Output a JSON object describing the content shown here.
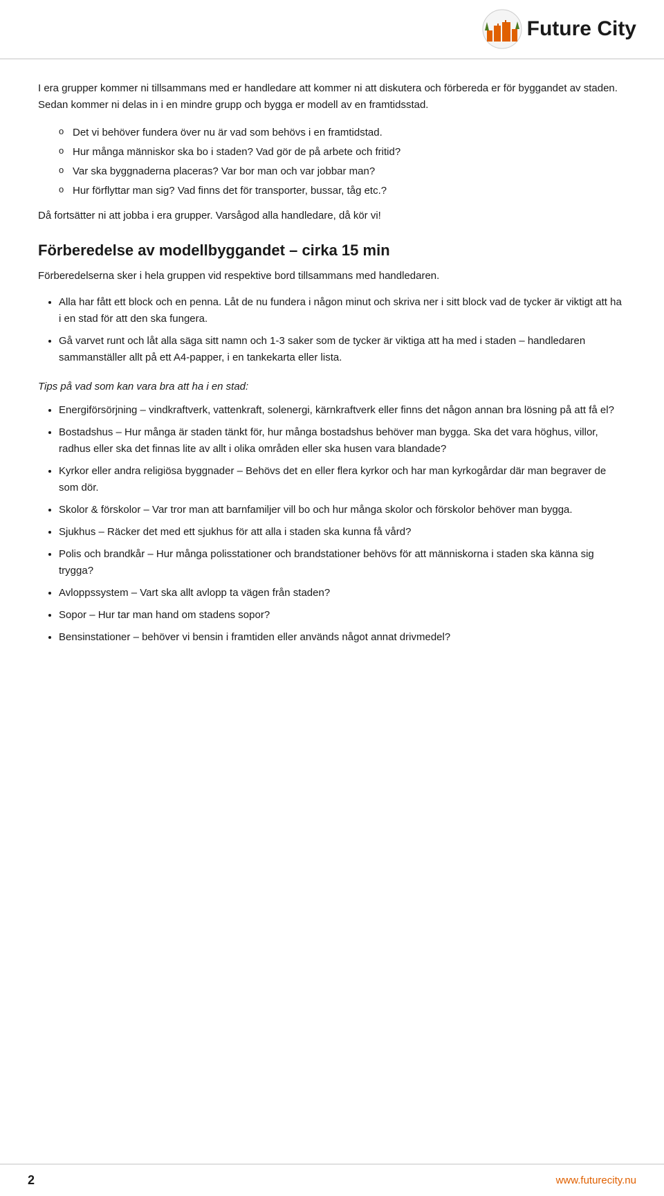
{
  "header": {
    "logo_text": "Future City",
    "logo_future": "Future",
    "logo_city": "City"
  },
  "content": {
    "intro_paragraph": "I era grupper kommer ni tillsammans med er handledare att kommer ni att diskutera och förbereda er för byggandet av staden. Sedan kommer ni delas in i en mindre grupp och bygga er modell av en framtidsstad.",
    "bullet_items": [
      "Det vi behöver fundera över nu är vad som behövs i en framtidstad.",
      "Hur många människor ska bo i staden? Vad gör de på arbete och fritid?",
      "Var ska byggnaderna placeras? Var bor man och var jobbar man?",
      "Hur förflyttar man sig? Vad finns det för transporter, bussar, tåg etc.?"
    ],
    "continuation1": "Då fortsätter ni att jobba i era grupper. Varsågod alla handledare, då kör vi!",
    "section_heading": "Förberedelse av modellbyggandet – cirka 15 min",
    "section_sub_text": "Förberedelserna sker i hela gruppen vid respektive bord tillsammans med handledaren.",
    "dot_items": [
      "Alla har fått ett block och en penna. Låt de nu fundera i någon minut och skriva ner i sitt block vad de tycker är viktigt att ha i en stad för att den ska fungera.",
      "Gå varvet runt och låt alla säga sitt namn och 1-3 saker som de tycker är viktiga att ha med i staden – handledaren sammanställer allt på ett A4-papper, i en tankekarta eller lista."
    ],
    "tips_heading": "Tips på vad som kan vara bra att ha i en stad:",
    "tips_items": [
      "Energiförsörjning – vindkraftverk, vattenkraft, solenergi, kärnkraftverk eller finns det någon annan bra lösning på att få el?",
      "Bostadshus – Hur många är staden tänkt för, hur många bostadshus behöver man bygga. Ska det vara höghus, villor, radhus eller ska det finnas lite av allt i olika områden eller ska husen vara blandade?",
      "Kyrkor eller andra religiösa byggnader – Behövs det en eller flera kyrkor och har man kyrkogårdar där man begraver de som dör.",
      "Skolor & förskolor – Var tror man att barnfamiljer vill bo och hur många skolor och förskolor behöver man bygga.",
      "Sjukhus – Räcker det med ett sjukhus för att alla i staden ska kunna få vård?",
      "Polis och brandkår – Hur många polisstationer och brandstationer behövs för att människorna i staden ska känna sig trygga?",
      "Avloppssystem – Vart ska allt avlopp ta vägen från staden?",
      "Sopor – Hur tar man hand om stadens sopor?",
      "Bensinstationer – behöver vi bensin i framtiden eller används något annat drivmedel?"
    ]
  },
  "footer": {
    "page_number": "2",
    "url": "www.futurecity.nu"
  }
}
